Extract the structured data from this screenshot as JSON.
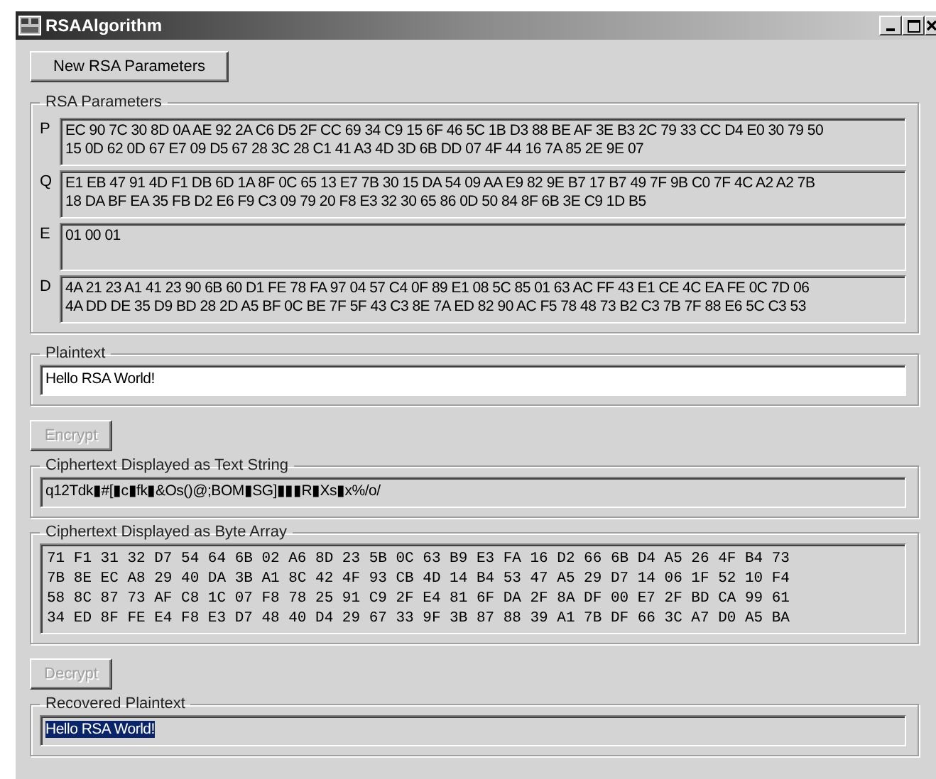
{
  "window": {
    "title": "RSAAlgorithm"
  },
  "new_params_button": {
    "label": "New RSA Parameters",
    "disabled": false
  },
  "rsa_parameters": {
    "label": "RSA Parameters",
    "fields": [
      {
        "letter": "P",
        "lines": [
          "EC 90 7C 30 8D 0A AE 92 2A C6 D5 2F CC 69 34 C9 15 6F 46 5C 1B D3 88 BE AF 3E B3 2C 79 33 CC D4 E0 30 79 50",
          "15 0D 62 0D 67 E7 09 D5 67 28 3C 28 C1 41 A3 4D 3D 6B DD 07 4F 44 16 7A 85 2E 9E 07"
        ]
      },
      {
        "letter": "Q",
        "lines": [
          "E1 EB 47 91 4D F1 DB 6D 1A 8F 0C 65 13 E7 7B 30 15 DA 54 09 AA E9 82 9E B7 17 B7 49 7F 9B C0 7F 4C A2 A2 7B",
          "18 DA BF EA 35 FB D2 E6 F9 C3 09 79 20 F8 E3 32 30 65 86 0D 50 84 8F 6B 3E C9 1D B5"
        ]
      },
      {
        "letter": "E",
        "lines": [
          "01 00 01"
        ]
      },
      {
        "letter": "D",
        "lines": [
          "4A 21 23 A1 41 23 90 6B 60 D1 FE 78 FA 97 04 57 C4 0F 89 E1 08 5C 85 01 63 AC FF 43 E1 CE 4C EA FE 0C 7D 06",
          "4A DD DE 35 D9 BD 28 2D A5 BF 0C BE 7F 5F 43 C3 8E 7A ED 82 90 AC F5 78 48 73 B2 C3 7B 7F 88 E6 5C C3 53"
        ]
      }
    ]
  },
  "plaintext": {
    "label": "Plaintext",
    "value": "Hello RSA World!",
    "read_only": false,
    "selected": false
  },
  "encrypt_button": {
    "label": "Encrypt",
    "disabled": true
  },
  "cipher_text": {
    "label": "Ciphertext Displayed as Text String",
    "value": "q12Tdk▮#[▮c▮fk▮&Os()@;BOM▮SG]▮▮▮R▮Xs▮x%/o/",
    "read_only": true,
    "selected": false
  },
  "cipher_bytes": {
    "label": "Ciphertext Displayed as Byte Array",
    "lines": [
      "71 F1 31 32 D7 54 64 6B 02 A6 8D 23 5B 0C 63 B9 E3 FA 16 D2 66 6B D4 A5 26 4F B4 73",
      "7B 8E EC A8 29 40 DA 3B A1 8C 42 4F 93 CB 4D 14 B4 53 47 A5 29 D7 14 06 1F 52 10 F4",
      "58 8C 87 73 AF C8 1C 07 F8 78 25 91 C9 2F E4 81 6F DA 2F 8A DF 00 E7 2F BD CA 99 61",
      "34 ED 8F FE E4 F8 E3 D7 48 40 D4 29 67 33 9F 3B 87 88 39 A1 7B DF 66 3C A7 D0 A5 BA"
    ]
  },
  "decrypt_button": {
    "label": "Decrypt",
    "disabled": true
  },
  "recovered": {
    "label": "Recovered Plaintext",
    "value": "Hello RSA World!",
    "read_only": true,
    "selected": true
  }
}
